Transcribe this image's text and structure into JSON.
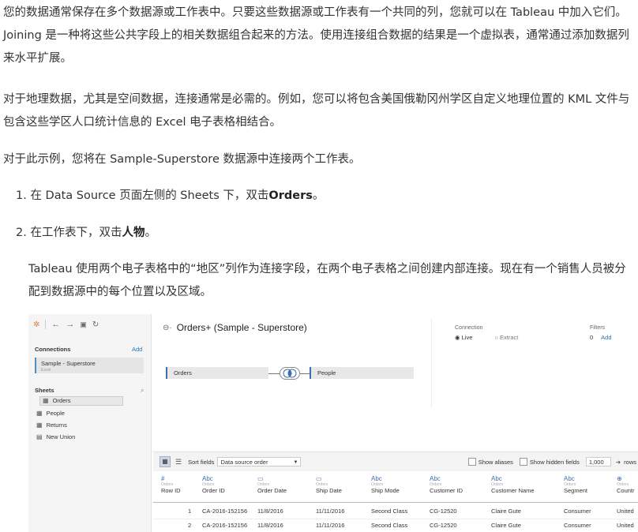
{
  "doc": {
    "p1": "您的数据通常保存在多个数据源或工作表中。只要这些数据源或工作表有一个共同的列，您就可以在 Tableau 中加入它们。Joining 是一种将这些公共字段上的相关数据组合起来的方法。使用连接组合数据的结果是一个虚拟表，通常通过添加数据列来水平扩展。",
    "p2": "对于地理数据，尤其是空间数据，连接通常是必需的。例如，您可以将包含美国俄勒冈州学区自定义地理位置的 KML 文件与包含这些学区人口统计信息的 Excel 电子表格相结合。",
    "p3": "对于此示例，您将在 Sample-Superstore 数据源中连接两个工作表。",
    "step1_prefix": "1. 在 Data Source 页面左侧的 Sheets 下，双击",
    "step1_bold": "Orders",
    "step1_suffix": "。",
    "step2_prefix": "2. 在工作表下，双击",
    "step2_bold": "人物",
    "step2_suffix": "。",
    "p4": "Tableau 使用两个电子表格中的“地区”列作为连接字段，在两个电子表格之间创建内部连接。现在有一个销售人员被分配到数据源中的每个位置以及区域。"
  },
  "tableau": {
    "connections_label": "Connections",
    "add_label": "Add",
    "source_name": "Sample - Superstore",
    "source_type": "Excel",
    "sheets_label": "Sheets",
    "sheets": [
      {
        "label": "Orders",
        "icon": "sheet-icon"
      },
      {
        "label": "People",
        "icon": "sheet-icon"
      },
      {
        "label": "Returns",
        "icon": "sheet-icon"
      },
      {
        "label": "New Union",
        "icon": "union-icon"
      }
    ],
    "datasource_title": "Orders+ (Sample - Superstore)",
    "connection_label": "Connection",
    "live_label": "Live",
    "extract_label": "Extract",
    "filters_label": "Filters",
    "filters_count": "0",
    "filters_add": "Add",
    "left_table": "Orders",
    "right_table": "People",
    "sort_label": "Sort fields",
    "sort_value": "Data source order",
    "show_aliases": "Show aliases",
    "show_hidden": "Show hidden fields",
    "rows_value": "1,000",
    "rows_label": "rows",
    "columns": [
      {
        "icon": "#",
        "source": "Orders",
        "name": "Row ID"
      },
      {
        "icon": "Abc",
        "source": "Orders",
        "name": "Order ID"
      },
      {
        "icon": "▭",
        "source": "Orders",
        "name": "Order Date"
      },
      {
        "icon": "▭",
        "source": "Orders",
        "name": "Ship Date"
      },
      {
        "icon": "Abc",
        "source": "Orders",
        "name": "Ship Mode"
      },
      {
        "icon": "Abc",
        "source": "Orders",
        "name": "Customer ID"
      },
      {
        "icon": "Abc",
        "source": "Orders",
        "name": "Customer Name"
      },
      {
        "icon": "Abc",
        "source": "Orders",
        "name": "Segment"
      },
      {
        "icon": "⊕",
        "source": "Orders",
        "name": "Countr"
      }
    ],
    "rows": [
      [
        "1",
        "CA-2016-152156",
        "11/8/2016",
        "11/11/2016",
        "Second Class",
        "CG-12520",
        "Claire Gute",
        "Consumer",
        "United"
      ],
      [
        "2",
        "CA-2016-152156",
        "11/8/2016",
        "11/11/2016",
        "Second Class",
        "CG-12520",
        "Claire Gute",
        "Consumer",
        "United"
      ]
    ]
  }
}
